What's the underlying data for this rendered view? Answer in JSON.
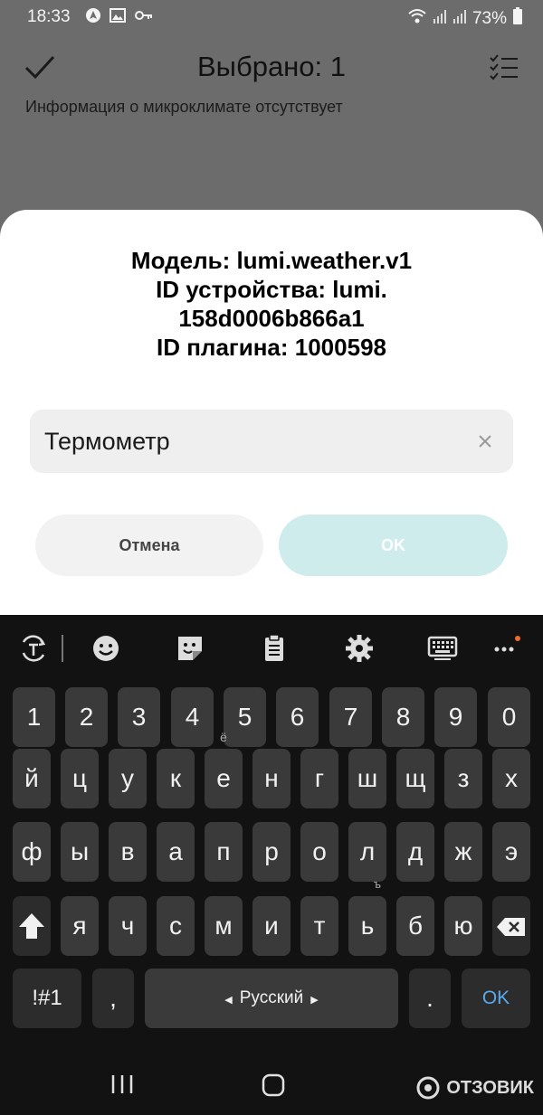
{
  "status_bar": {
    "time": "18:33",
    "battery": "73%",
    "icons_left": [
      "navigation-icon",
      "image-icon",
      "key-icon"
    ],
    "icons_right": [
      "wifi-icon",
      "signal-icon",
      "signal-icon",
      "battery-icon"
    ]
  },
  "header": {
    "title": "Выбрано: 1"
  },
  "background_text": "Информация о микроклимате отсутствует",
  "dialog": {
    "model_line": "Модель:  lumi.weather.v1",
    "device_id_line1": "ID устройства:  lumi.",
    "device_id_line2": "158d0006b866a1",
    "plugin_id_line": "ID плагина: 1000598",
    "name_value": "Термометр",
    "cancel_label": "Отмена",
    "ok_label": "OK"
  },
  "keyboard": {
    "toolbar_icons": [
      "translate-icon",
      "emoji-icon",
      "sticker-icon",
      "clipboard-icon",
      "settings-icon",
      "keyboard-icon",
      "more-icon"
    ],
    "row_numbers": [
      "1",
      "2",
      "3",
      "4",
      "5",
      "6",
      "7",
      "8",
      "9",
      "0"
    ],
    "row1": [
      "й",
      "ц",
      "у",
      "к",
      "е",
      "н",
      "г",
      "ш",
      "щ",
      "з",
      "х"
    ],
    "row1_sup_e": "ё",
    "row2": [
      "ф",
      "ы",
      "в",
      "а",
      "п",
      "р",
      "о",
      "л",
      "д",
      "ж",
      "э"
    ],
    "row3": [
      "я",
      "ч",
      "с",
      "м",
      "и",
      "т",
      "ь",
      "б",
      "ю"
    ],
    "row3_sup_soft": "ъ",
    "sym_label": "!#1",
    "comma_label": ",",
    "space_label": "Русский",
    "period_label": ".",
    "ok_label": "OK"
  },
  "watermark": "ОТЗОВИК",
  "colors": {
    "dim_background": "#6c6c6c",
    "dialog_bg": "#ffffff",
    "ok_button_bg": "#ceecec",
    "keyboard_bg": "#121212",
    "key_bg": "#3a3a3a",
    "keyboard_ok_text": "#5aa9ea",
    "notification_dot": "#f26b2b"
  }
}
